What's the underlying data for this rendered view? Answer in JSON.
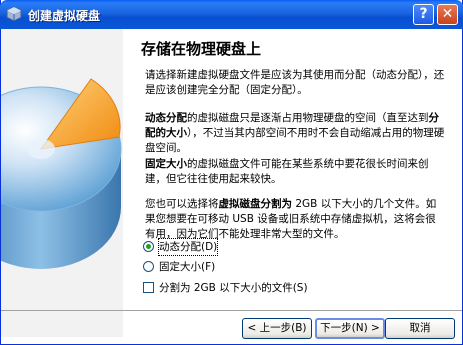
{
  "window": {
    "title": "创建虚拟硬盘",
    "help_label": "?",
    "close_label": "✕"
  },
  "page": {
    "title": "存储在物理硬盘上",
    "paragraphs": [
      "请选择新建虚拟硬盘文件是应该为其使用而分配（动态分配），还是应该创建完全分配（固定分配）。",
      "<b>动态分配</b>的虚拟磁盘只是逐渐占用物理硬盘的空间（直至达到<b>分配的大小</b>），不过当其内部空间不用时不会自动缩减占用的物理硬盘空间。",
      "<b>固定大小</b>的虚拟磁盘文件可能在某些系统中要花很长时间来创建，但它往往使用起来较快。",
      "您也可以选择将<b>虚拟磁盘分割为</b> 2GB 以下大小的几个文件。如果您想要在可移动 USB 设备或旧系统中存储虚拟机，这将会很有用，因为它们不能处理非常大型的文件。"
    ]
  },
  "options": {
    "dynamic_label": "动态分配(D)",
    "fixed_label": "固定大小(F)",
    "split_label": "分割为 2GB 以下大小的文件(S)"
  },
  "buttons": {
    "back_label": "< 上一步(B)",
    "next_label": "下一步(N) >",
    "cancel_label": "取消"
  },
  "colors": {
    "titlebar": "#0a56d8",
    "disk_blue": "#5a9fd4",
    "disk_slice": "#f5a623"
  },
  "icons": {
    "app": "virtualbox-icon",
    "art": "disk-pie-illustration"
  }
}
